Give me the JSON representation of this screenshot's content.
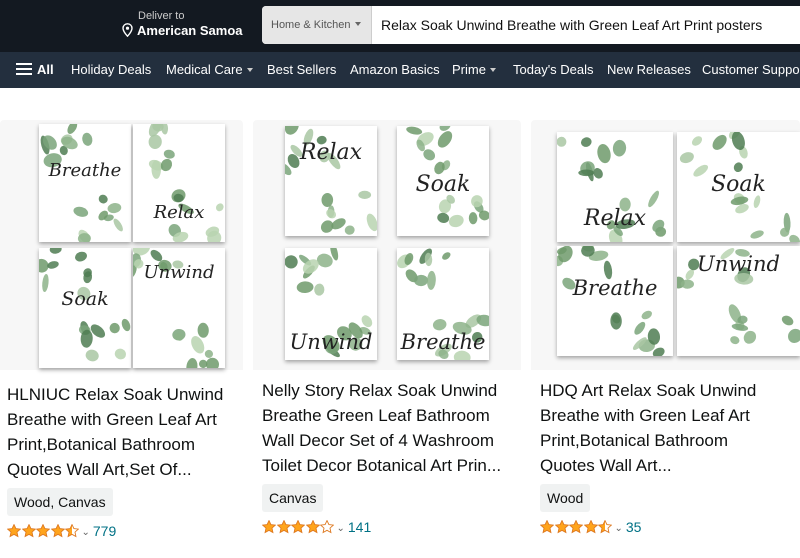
{
  "header": {
    "deliver_line1": "Deliver to",
    "deliver_line2": "American Samoa",
    "search_category": "Home & Kitchen",
    "search_query": "Relax Soak Unwind Breathe with Green Leaf Art Print posters"
  },
  "nav": {
    "all": "All",
    "items": [
      "Holiday Deals",
      "Medical Care",
      "Best Sellers",
      "Amazon Basics",
      "Prime",
      "Today's Deals",
      "New Releases",
      "Customer Support"
    ]
  },
  "products": [
    {
      "title_lines": [
        "HLNIUC Relax Soak Unwind",
        "Breathe with Green Leaf Art",
        "Print,Botanical Bathroom",
        "Quotes Wall Art,Set Of..."
      ],
      "material": "Wood, Canvas",
      "rating": 4.5,
      "reviews": "779",
      "poster_words": [
        "Breathe",
        "Relax",
        "Soak",
        "Unwind"
      ]
    },
    {
      "title_lines": [
        "Nelly Story Relax Soak Unwind",
        "Breathe Green Leaf Bathroom",
        "Wall Decor Set of 4 Washroom",
        "Toilet Decor Botanical Art Prin..."
      ],
      "material": "Canvas",
      "rating": 4.0,
      "reviews": "141",
      "poster_words": [
        "Relax",
        "Soak",
        "Unwind",
        "Breathe"
      ]
    },
    {
      "title_lines": [
        "HDQ Art Relax Soak Unwind",
        "Breathe with Green Leaf Art",
        "Print,Botanical Bathroom",
        "Quotes Wall Art..."
      ],
      "material": "Wood",
      "rating": 4.5,
      "reviews": "35",
      "poster_words": [
        "Relax",
        "Soak",
        "Breathe",
        "Unwind"
      ]
    }
  ],
  "colors": {
    "header_bg": "#131921",
    "nav_bg": "#232f3e",
    "star": "#ffa41c",
    "link": "#007185",
    "badge_bg": "#f0f2f2"
  }
}
